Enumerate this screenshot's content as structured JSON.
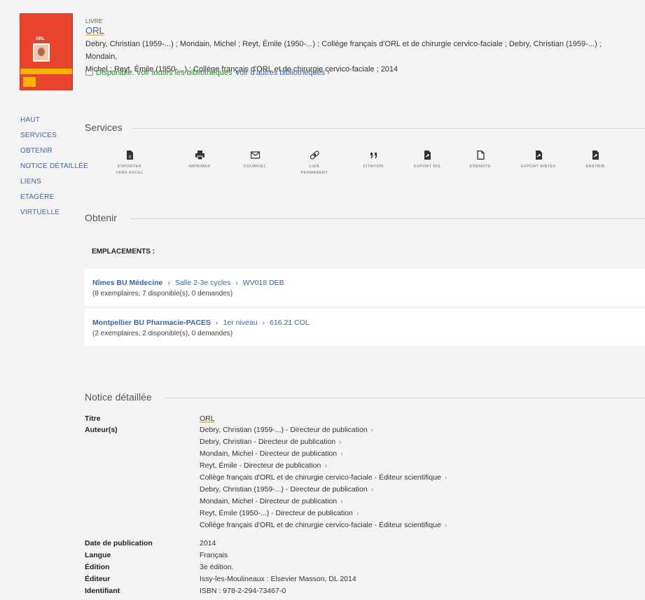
{
  "record": {
    "type": "LIVRE",
    "title": "ORL",
    "authors_line1": "Debry, Christian (1959-...) ; Mondain, Michel ; Reyt, Émile (1950-...) ; Collège français d'ORL et de chirurgie cervico-faciale ; Debry, Christian (1959-...) ; Mondain,",
    "authors_line2": "Michel ; Reyt, Émile (1950-...) ; Collège français d'ORL et de chirurgie cervico-faciale ; 2014",
    "available": "Disponible. Voir toutes les bibliothèques",
    "other_libraries": "Voir d'autres bibliothèques",
    "chevron": "›",
    "cover": {
      "label": "ORL"
    }
  },
  "nav": [
    "HAUT",
    "SERVICES",
    "OBTENIR",
    "NOTICE DÉTAILLÉE",
    "LIENS",
    "ETAGÈRE",
    "VIRTUELLE"
  ],
  "sections": {
    "services": "Services",
    "obtenir": "Obtenir",
    "notice": "Notice détaillée"
  },
  "services": [
    {
      "icon": "excel-icon",
      "l1": "EXPORTER",
      "l2": "VERS EXCEL"
    },
    {
      "icon": "print-icon",
      "l1": "IMPRIMER",
      "l2": ""
    },
    {
      "icon": "mail-icon",
      "l1": "COURRIEL",
      "l2": ""
    },
    {
      "icon": "link-icon",
      "l1": "LIEN",
      "l2": "PERMANENT"
    },
    {
      "icon": "quote-icon",
      "l1": "CITATION",
      "l2": ""
    },
    {
      "icon": "file-export-icon",
      "l1": "EXPORT RIS",
      "l2": ""
    },
    {
      "icon": "file-icon",
      "l1": "ENDNOTE",
      "l2": ""
    },
    {
      "icon": "file-export-icon",
      "l1": "EXPORT BIBTEX",
      "l2": ""
    },
    {
      "icon": "file-export-icon",
      "l1": "EASYBIB",
      "l2": ""
    }
  ],
  "obtenir": {
    "emplacements": "EMPLACEMENTS :",
    "locations": [
      {
        "library": "Nîmes BU Médecine",
        "room": "Salle 2-3e cycles",
        "callnumber": "WV018 DEB",
        "summary": "(8 exemplaires, 7 disponible(s), 0 demandes)"
      },
      {
        "library": "Montpellier BU Pharmacie-PACES",
        "room": "1er niveau",
        "callnumber": "616.21 COL",
        "summary": "(2 exemplaires, 2 disponible(s), 0 demandes)"
      }
    ]
  },
  "notice": {
    "titre_label": "Titre",
    "titre": "ORL",
    "auteurs_label": "Auteur(s)",
    "auteurs": [
      "Debry, Christian (1959-...) - Directeur de publication",
      "Debry, Christian - Directeur de publication",
      "Mondain, Michel - Directeur de publication",
      "Reyt, Émile - Directeur de publication",
      "Collège français d'ORL et de chirurgie cervico-faciale - Éditeur scientifique",
      "Debry, Christian (1959-...) - Directeur de publication",
      "Mondain, Michel - Directeur de publication",
      "Reyt, Émile (1950-...) - Directeur de publication",
      "Collège français d'ORL et de chirurgie cervico-faciale - Éditeur scientifique"
    ],
    "date_label": "Date de publication",
    "date": "2014",
    "langue_label": "Langue",
    "langue": "Français",
    "edition_label": "Édition",
    "edition": "3e édition.",
    "editeur_label": "Éditeur",
    "editeur": "Issy-les-Moulineaux : Elsevier Masson, DL 2014",
    "identifiant_label": "Identifiant",
    "identifiant": "ISBN : 978-2-294-73467-0"
  },
  "colors": {
    "link": "#3a64b4",
    "available": "#2e8b2e",
    "highlight": "#f2c14e"
  }
}
